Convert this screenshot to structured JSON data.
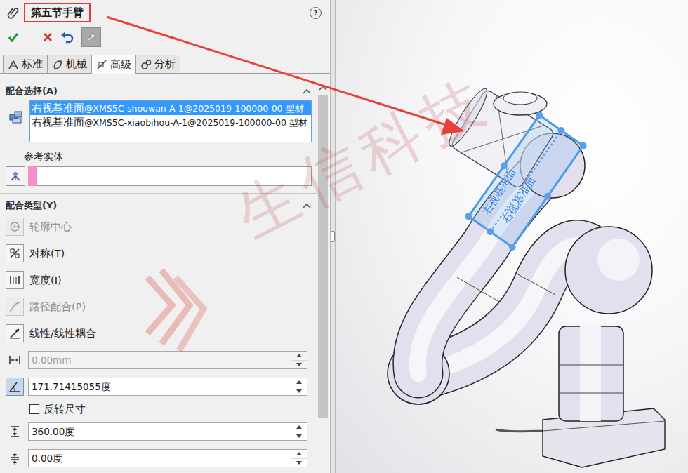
{
  "property_manager": {
    "title": "第五节手臂",
    "help": "?"
  },
  "tabs": [
    {
      "label": "标准",
      "selected": false
    },
    {
      "label": "机械",
      "selected": false
    },
    {
      "label": "高级",
      "selected": true
    },
    {
      "label": "分析",
      "selected": false
    }
  ],
  "mate_selections": {
    "header": "配合选择(A)",
    "items": [
      {
        "name": "右视基准面",
        "path": "@XMS5C-shouwan-A-1@2025019-100000-00 型材",
        "selected": true
      },
      {
        "name": "右视基准面",
        "path": "@XMS5C-xiaobihou-A-1@2025019-100000-00 型材",
        "selected": false
      }
    ],
    "reference_label": "参考实体"
  },
  "mate_types": {
    "header": "配合类型(Y)",
    "items": [
      {
        "label": "轮廓中心",
        "disabled": true
      },
      {
        "label": "对称(T)",
        "disabled": false
      },
      {
        "label": "宽度(I)",
        "disabled": false
      },
      {
        "label": "路径配合(P)",
        "disabled": true
      },
      {
        "label": "线性/线性耦合",
        "disabled": false
      }
    ]
  },
  "dimensions": [
    {
      "kind": "field",
      "value": "0.00mm",
      "disabled": true,
      "selected": false
    },
    {
      "kind": "field",
      "value": "171.71415055度",
      "disabled": false,
      "selected": true
    },
    {
      "kind": "checkbox",
      "label": "反转尺寸",
      "checked": false
    },
    {
      "kind": "field",
      "value": "360.00度",
      "disabled": false,
      "selected": false
    },
    {
      "kind": "field",
      "value": "0.00度",
      "disabled": false,
      "selected": false
    }
  ],
  "viewport": {
    "plane_labels": [
      "右视基准面",
      "右视基准面"
    ]
  },
  "watermark": "生信科技"
}
